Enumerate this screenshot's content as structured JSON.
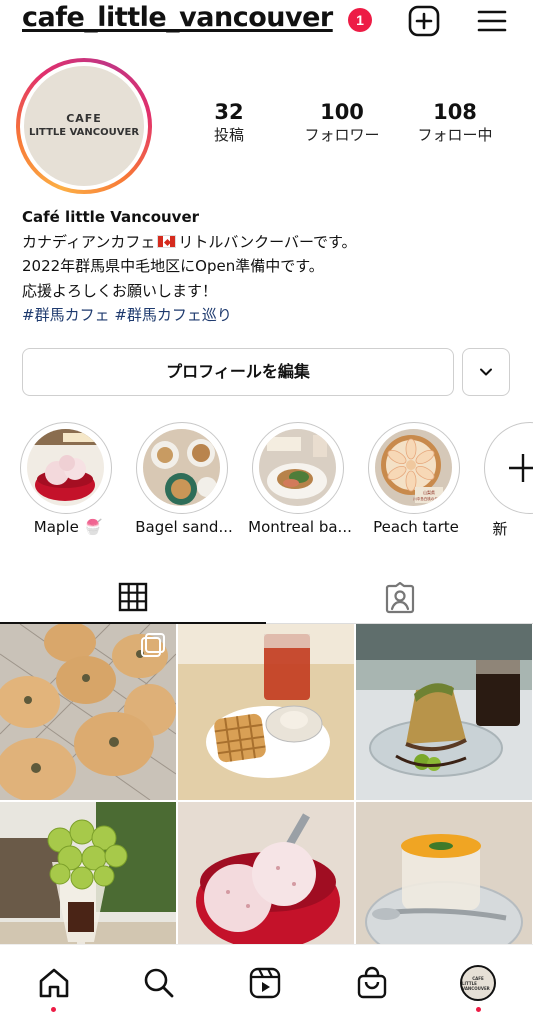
{
  "header": {
    "username": "cafe_little_vancouver",
    "notification_count": "1"
  },
  "profile": {
    "avatar_text_line1": "CAFE",
    "avatar_text_line2": "LITTLE VANCOUVER",
    "stats": [
      {
        "value": "32",
        "label": "投稿"
      },
      {
        "value": "100",
        "label": "フォロワー"
      },
      {
        "value": "108",
        "label": "フォロー中"
      }
    ]
  },
  "bio": {
    "name": "Café little Vancouver",
    "line1_before": "カナディアンカフェ",
    "line1_after": "リトルバンクーバーです。",
    "line2": "2022年群馬県中毛地区にOpen準備中です。",
    "line3": "応援よろしくお願いします！",
    "hashtags": "#群馬カフェ #群馬カフェ巡り"
  },
  "actions": {
    "edit_profile_label": "プロフィールを編集"
  },
  "highlights": [
    {
      "label": "Maple 🍧"
    },
    {
      "label": "Bagel sand..."
    },
    {
      "label": "Montreal ba..."
    },
    {
      "label": "Peach tarte"
    },
    {
      "label": "新"
    }
  ],
  "highlight_overlay": {
    "peach_sign_line1": "山梨県",
    "peach_sign_line2": "川中島白桃のタルト"
  },
  "colors": {
    "accent_red": "#ed1c45",
    "hashtag": "#1e3a6e"
  },
  "icons": {
    "new_post": "plus-square-icon",
    "menu": "hamburger-menu-icon",
    "grid_tab": "grid-icon",
    "tagged_tab": "tagged-person-icon",
    "nav": [
      "home-icon",
      "search-icon",
      "reels-icon",
      "shop-icon",
      "profile-avatar"
    ]
  }
}
